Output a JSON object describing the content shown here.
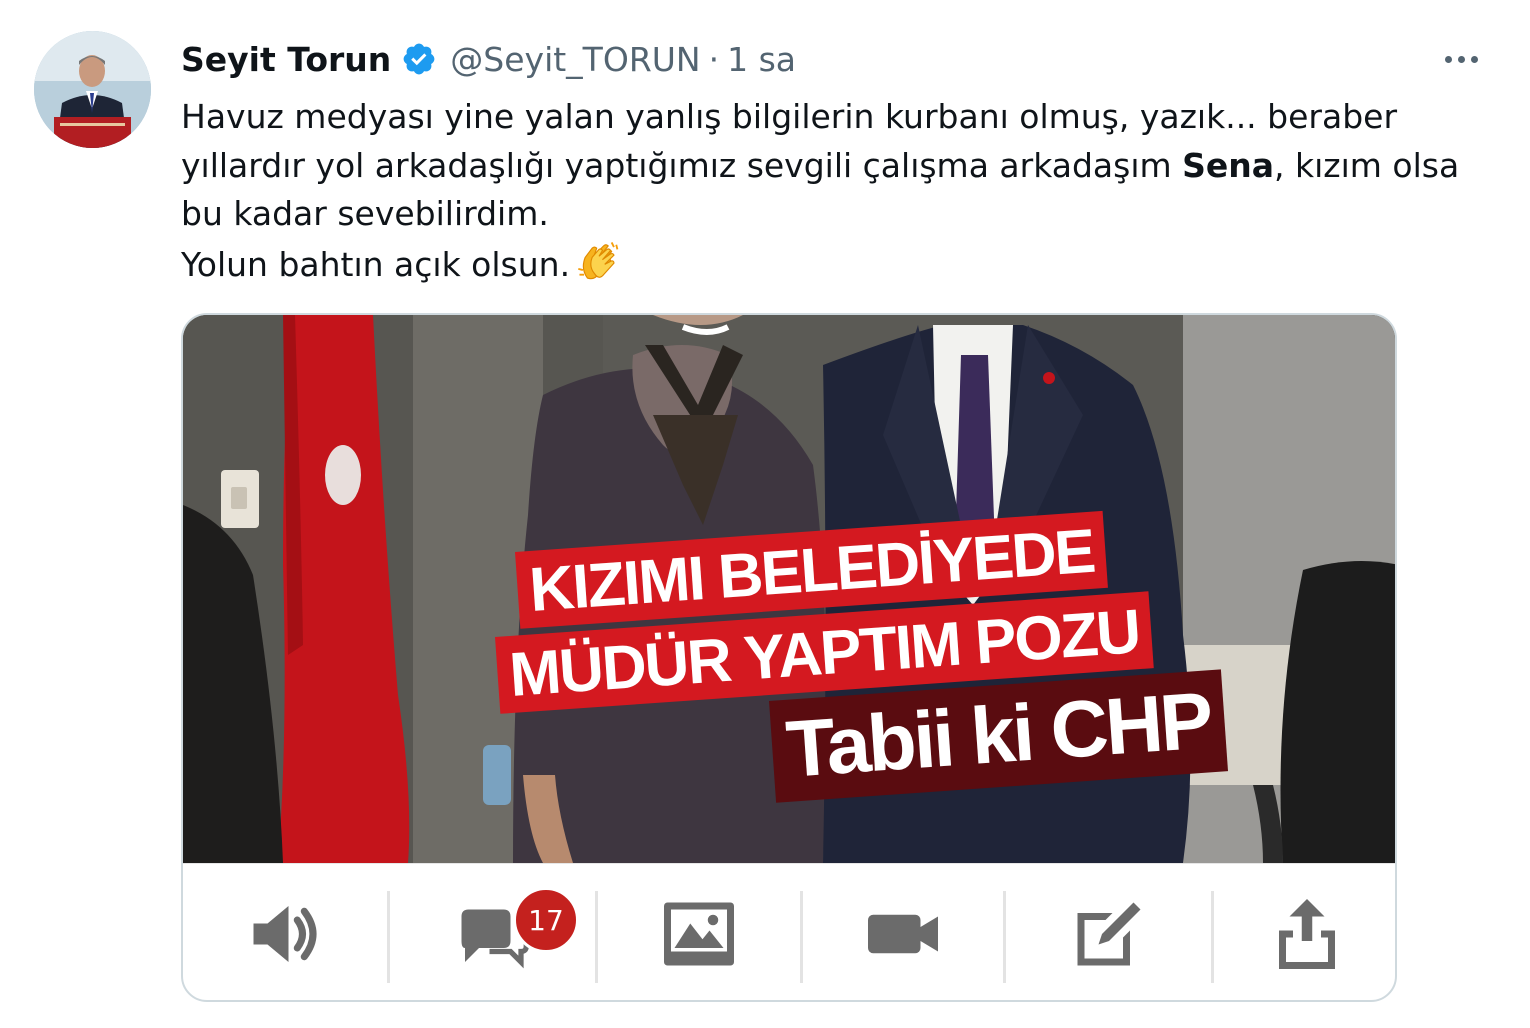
{
  "author": {
    "name": "Seyit Torun",
    "handle": "@Seyit_TORUN",
    "separator": "·",
    "time": "1 sa"
  },
  "tweet": {
    "line1": "Havuz medyası yine yalan yanlış bilgilerin kurbanı olmuş, yazık... beraber",
    "line2_pre": "yıllardır yol arkadaşlığı yaptığımız sevgili çalışma arkadaşım ",
    "line2_bold": "Sena",
    "line2_post": ", kızım olsa",
    "line3": "bu kadar sevebilirdim.",
    "line4": "Yolun bahtın açık olsun.",
    "emoji": "clapping-hands"
  },
  "media": {
    "headline1": "KIZIMI BELEDİYEDE",
    "headline2": "MÜDÜR YAPTIM POZU",
    "headline3": "Tabii ki CHP"
  },
  "toolbar": {
    "items": [
      "speaker-icon",
      "chat-icon",
      "image-icon",
      "video-icon",
      "edit-icon",
      "share-icon"
    ],
    "comment_badge": "17"
  },
  "colors": {
    "verified": "#1d9bf0",
    "badge": "#c4211e",
    "headline_red": "#d41920",
    "headline_dark": "#5a0c10",
    "icon_gray": "#6b6b6b"
  }
}
